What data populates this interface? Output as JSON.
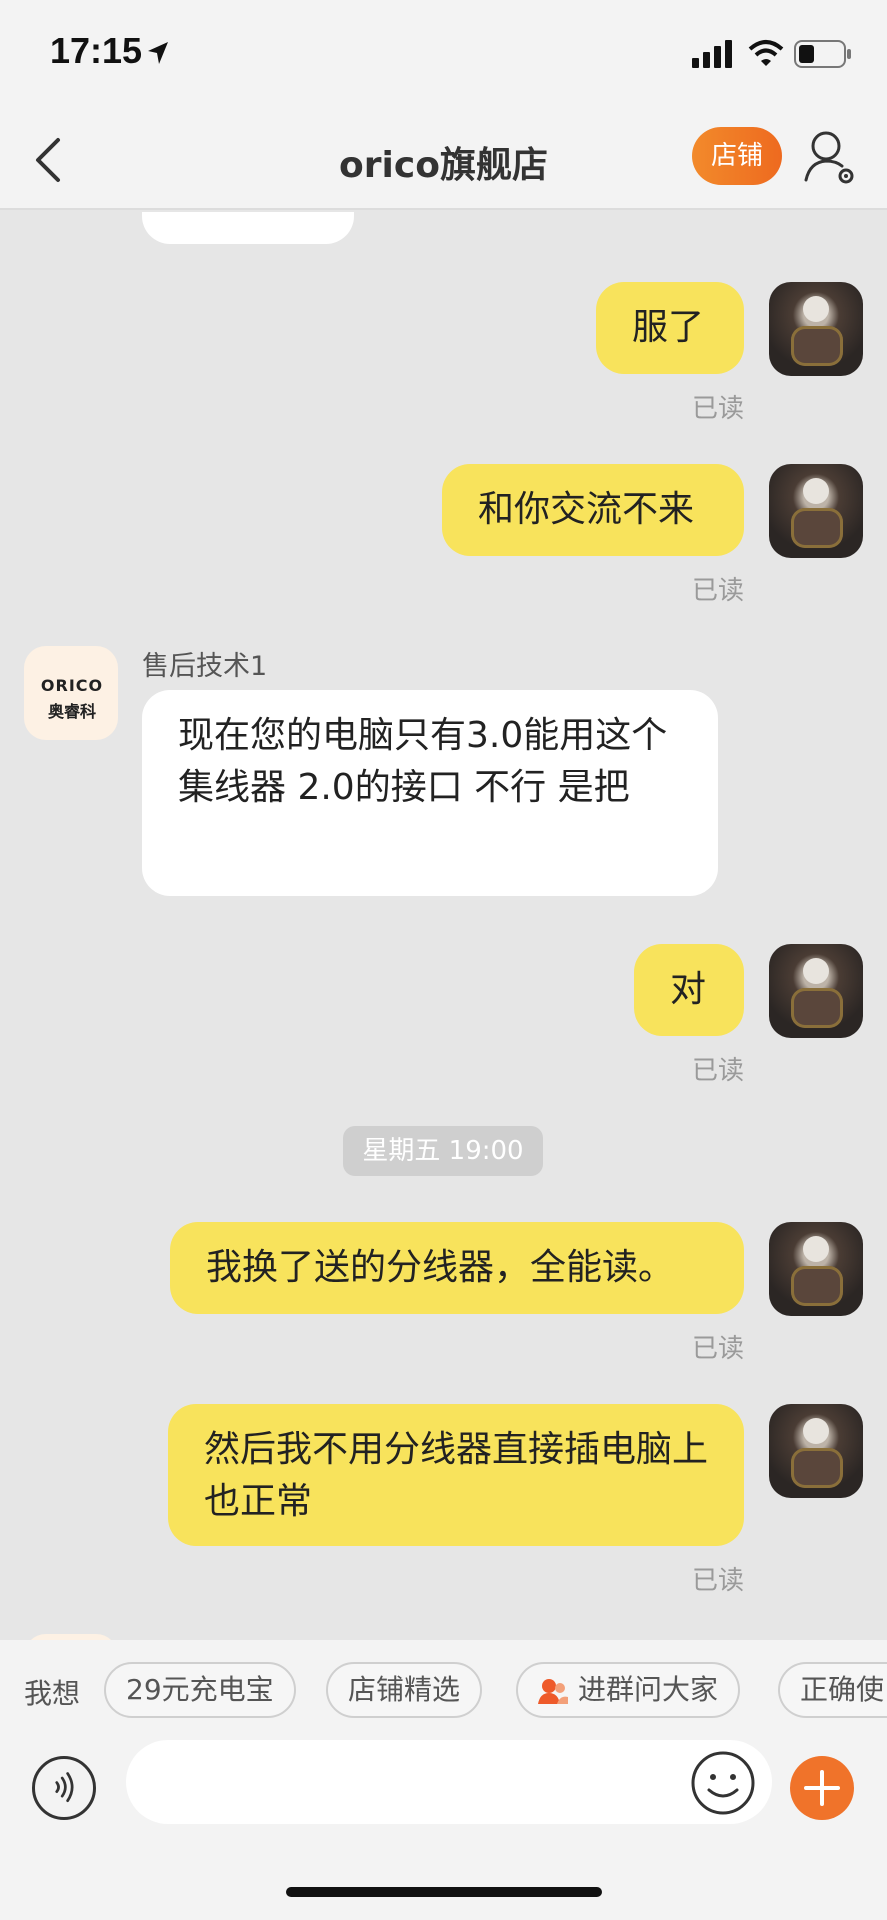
{
  "status_bar": {
    "time": "17:15"
  },
  "header": {
    "title": "orico旗舰店",
    "shop_button": "店铺"
  },
  "messages": [
    {
      "from": "me",
      "text": "服了",
      "status": "已读"
    },
    {
      "from": "me",
      "text": "和你交流不来",
      "status": "已读"
    },
    {
      "from": "shop",
      "sender": "售后技术1",
      "text": "现在您的电脑只有3.0能用这个集线器  2.0的接口 不行 是把"
    },
    {
      "from": "me",
      "text": "对",
      "status": "已读"
    },
    {
      "from": "me",
      "text": "我换了送的分线器，全能读。",
      "status": "已读"
    },
    {
      "from": "me",
      "text": "然后我不用分线器直接插电脑上也正常",
      "status": "已读"
    }
  ],
  "timestamp": "星期五 19:00",
  "shop_avatar": {
    "logo_top": "ORICO",
    "logo_bottom": "奥睿科"
  },
  "quick_bar": {
    "label": "我想",
    "chips": [
      "29元充电宝",
      "店铺精选",
      "进群问大家",
      "正确使"
    ]
  },
  "input": {
    "placeholder": ""
  },
  "colors": {
    "accent": "#f0732a",
    "my_bubble": "#f8e35c",
    "background": "#e6e6e6"
  },
  "icons": [
    "location-arrow-icon",
    "signal-icon",
    "wifi-icon",
    "battery-icon",
    "back-chevron-icon",
    "user-settings-icon",
    "voice-icon",
    "emoji-icon",
    "plus-icon",
    "group-icon"
  ]
}
